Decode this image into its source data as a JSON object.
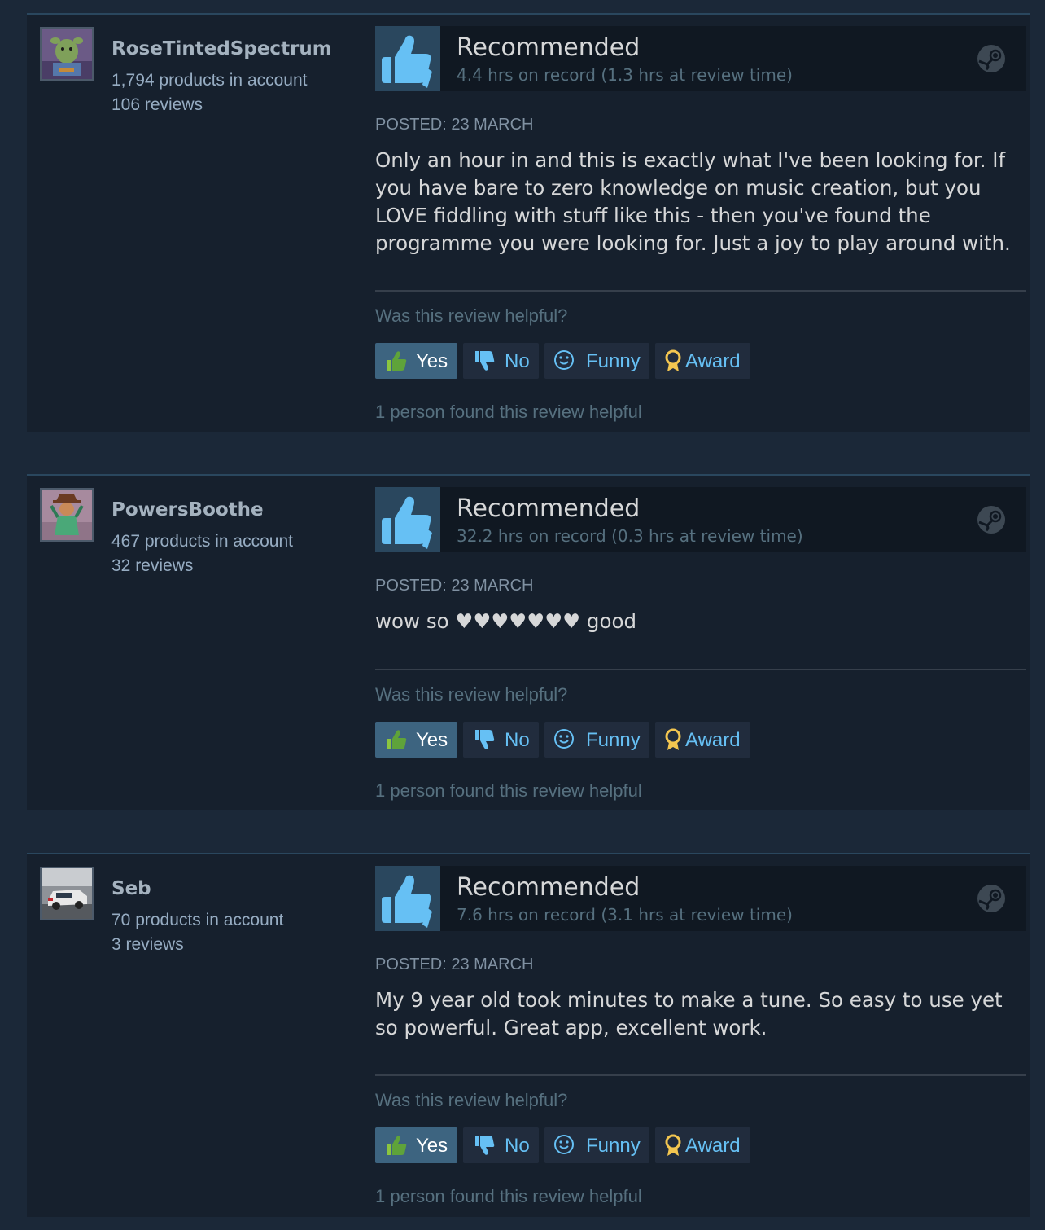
{
  "reviews": [
    {
      "author": {
        "name": "RoseTintedSpectrum",
        "products": "1,794 products in account",
        "reviews": "106 reviews"
      },
      "verdict": "Recommended",
      "hours": "4.4 hrs on record (1.3 hrs at review time)",
      "posted": "POSTED: 23 MARCH",
      "text": "Only an hour in and this is exactly what I've been looking for. If you have bare to zero knowledge on music creation, but you LOVE fiddling with stuff like this - then you've found the programme you were looking for. Just a joy to play around with.",
      "helpful_question": "Was this review helpful?",
      "buttons": {
        "yes": "Yes",
        "no": "No",
        "funny": "Funny",
        "award": "Award"
      },
      "found_helpful": "1 person found this review helpful"
    },
    {
      "author": {
        "name": "PowersBoothe",
        "products": "467 products in account",
        "reviews": "32 reviews"
      },
      "verdict": "Recommended",
      "hours": "32.2 hrs on record (0.3 hrs at review time)",
      "posted": "POSTED: 23 MARCH",
      "text": "wow so ♥♥♥♥♥♥♥ good",
      "helpful_question": "Was this review helpful?",
      "buttons": {
        "yes": "Yes",
        "no": "No",
        "funny": "Funny",
        "award": "Award"
      },
      "found_helpful": "1 person found this review helpful"
    },
    {
      "author": {
        "name": "Seb",
        "products": "70 products in account",
        "reviews": "3 reviews"
      },
      "verdict": "Recommended",
      "hours": "7.6 hrs on record (3.1 hrs at review time)",
      "posted": "POSTED: 23 MARCH",
      "text": "My 9 year old took minutes to make a tune. So easy to use yet so powerful. Great app, excellent work.",
      "helpful_question": "Was this review helpful?",
      "buttons": {
        "yes": "Yes",
        "no": "No",
        "funny": "Funny",
        "award": "Award"
      },
      "found_helpful": "1 person found this review helpful"
    }
  ],
  "colors": {
    "page_bg": "#1b2838",
    "card_bg": "#16202d",
    "accent_blue": "#66c0f4",
    "yes_button_bg": "#3d6480",
    "thumb_box_bg": "#2a475e",
    "award_gold": "#f3c650"
  },
  "icons": {
    "recommended": "thumbs-up-icon",
    "platform": "steam-logo-icon",
    "yes": "thumbs-up-green-icon",
    "no": "thumbs-down-icon",
    "funny": "smiley-icon",
    "award": "award-ribbon-icon"
  }
}
